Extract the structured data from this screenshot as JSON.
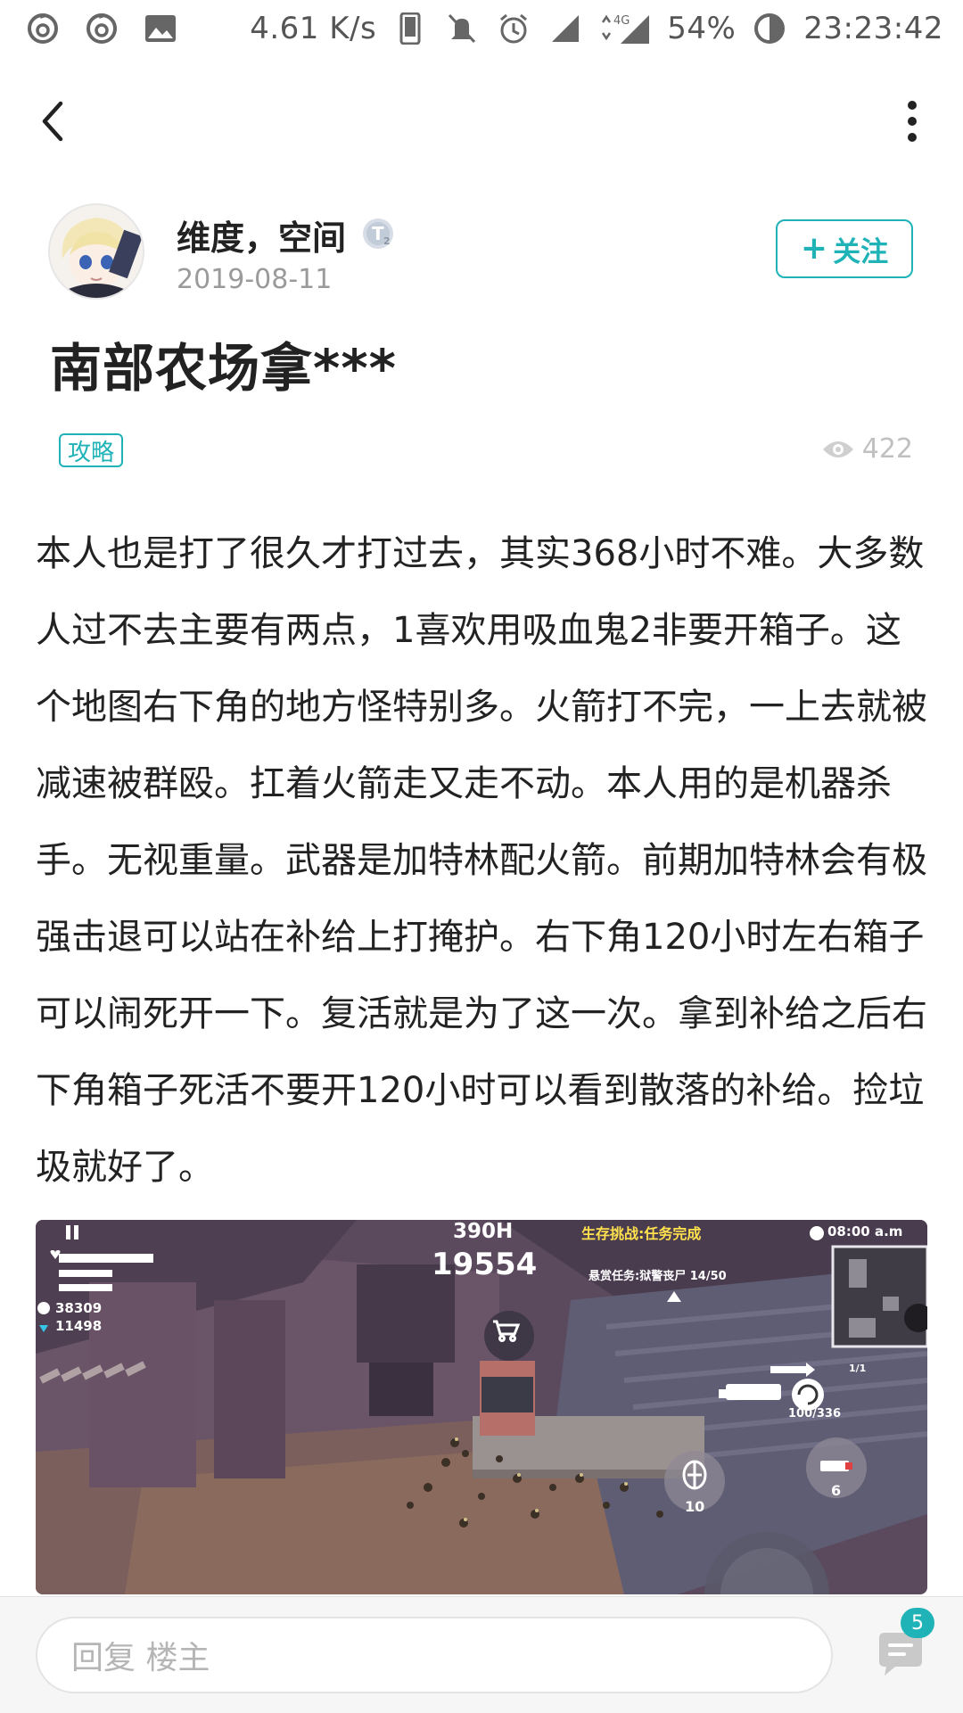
{
  "status_bar": {
    "speed": "4.61 K/s",
    "network": "4G",
    "battery": "54%",
    "time": "23:23:42"
  },
  "post": {
    "author": "维度，空间",
    "level_badge": "T2",
    "date": "2019-08-11",
    "follow_label": "关注",
    "title": "南部农场拿***",
    "tag": "攻略",
    "views": "422",
    "body": "本人也是打了很久才打过去，其实368小时不难。大多数人过不去主要有两点，1喜欢用吸血鬼2非要开箱子。这个地图右下角的地方怪特别多。火箭打不完，一上去就被减速被群殴。扛着火箭走又走不动。本人用的是机器杀手。无视重量。武器是加特林配火箭。前期加特林会有极强击退可以站在补给上打掩护。右下角120小时左右箱子可以闹死开一下。复活就是为了这一次。拿到补给之后右下角箱子死活不要开120小时可以看到散落的补给。捡垃圾就好了。"
  },
  "game_screenshot": {
    "hours": "390H",
    "score": "19554",
    "challenge": "生存挑战:任务完成",
    "bounty": "悬赏任务:狱警丧尸 14/50",
    "clock": "08:00 a.m",
    "gold": "38309",
    "gems": "11498",
    "ammo_main": "100/336",
    "ammo_ratio": "1/1",
    "grenades": "10",
    "rockets": "6"
  },
  "reply": {
    "placeholder": "回复  楼主",
    "comment_count": "5"
  },
  "colors": {
    "accent": "#1fb3b8",
    "muted": "#9a9a9a"
  }
}
